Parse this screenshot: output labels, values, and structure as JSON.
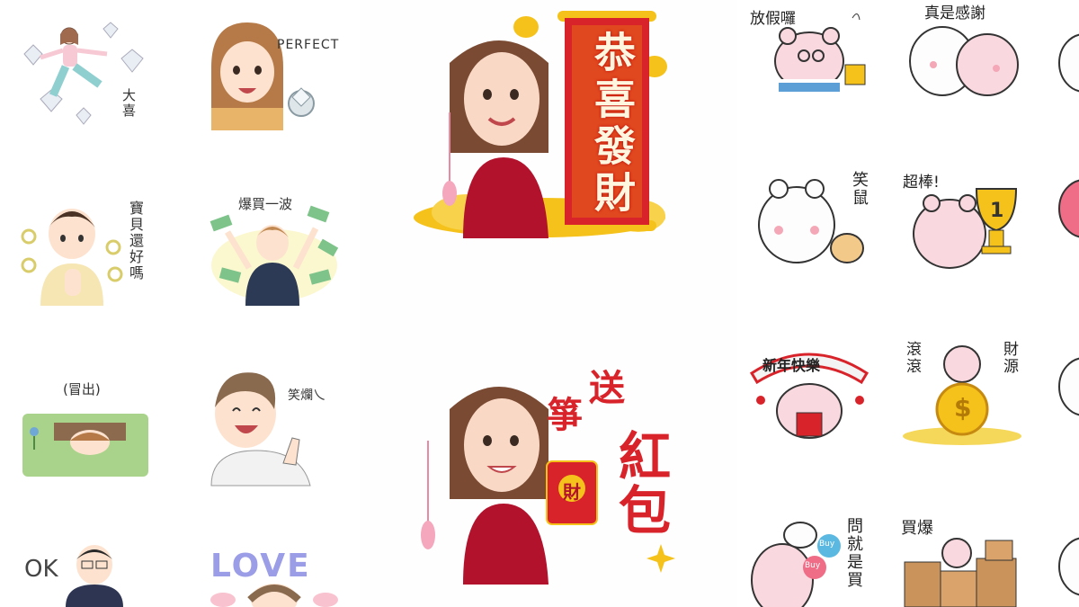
{
  "collage": {
    "left_set": {
      "stickers": [
        {
          "label": "大喜"
        },
        {
          "label": "PERFECT"
        },
        {
          "label": "寶貝還好嗎"
        },
        {
          "label": "爆買一波"
        },
        {
          "label": "(冒出)"
        },
        {
          "label": "笑爛乀"
        },
        {
          "label": "OK"
        },
        {
          "label": "LOVE"
        }
      ]
    },
    "middle_set": {
      "stickers": [
        {
          "banner_text": "恭喜發財"
        },
        {
          "side_text": "送",
          "side_text2": "箏",
          "big_text": "紅包",
          "envelope_text": "財"
        }
      ]
    },
    "right_set": {
      "stickers": [
        {
          "label": "放假囉"
        },
        {
          "label": "真是感謝"
        },
        {
          "label": "笑鼠"
        },
        {
          "label": "超棒!",
          "trophy_text": "1"
        },
        {
          "label": "新年快樂"
        },
        {
          "label_left": "滾滾",
          "label_right": "財源",
          "coin_text": "$"
        },
        {
          "label": "問就是買",
          "balloon1": "Buy",
          "balloon2": "Buy"
        },
        {
          "label": "買爆"
        }
      ]
    }
  },
  "colors": {
    "red": "#d8232a",
    "gold": "#f5c21b",
    "pink": "#f6c9cf",
    "green_money": "#7dc38a"
  }
}
